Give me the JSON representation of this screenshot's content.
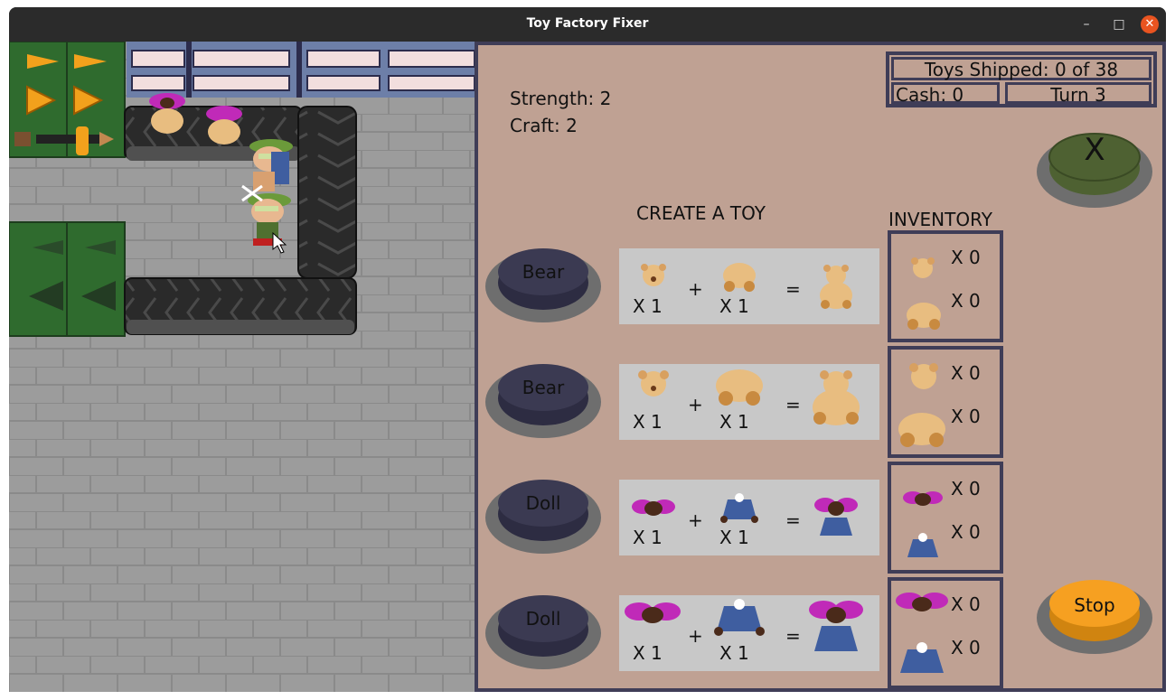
{
  "window": {
    "title": "Toy Factory Fixer",
    "minimize": "–",
    "maximize": "□",
    "close": "✕"
  },
  "stats": {
    "strength": "Strength: 2",
    "craft": "Craft: 2"
  },
  "status": {
    "toys_shipped": "Toys Shipped: 0 of 38",
    "cash": "Cash: 0",
    "turn": "Turn 3"
  },
  "controls": {
    "x_label": "X",
    "stop_label": "Stop"
  },
  "create": {
    "heading": "CREATE A TOY"
  },
  "inventory_heading": "INVENTORY",
  "recipes": [
    {
      "button": "Bear",
      "part_a": "X 1",
      "plus": "+",
      "part_b": "X 1",
      "eq": "="
    },
    {
      "button": "Bear",
      "part_a": "X 1",
      "plus": "+",
      "part_b": "X 1",
      "eq": "="
    },
    {
      "button": "Doll",
      "part_a": "X 1",
      "plus": "+",
      "part_b": "X 1",
      "eq": "="
    },
    {
      "button": "Doll",
      "part_a": "X 1",
      "plus": "+",
      "part_b": "X 1",
      "eq": "="
    }
  ],
  "inventory": [
    {
      "a": "X 0",
      "b": "X 0"
    },
    {
      "a": "X 0",
      "b": "X 0"
    },
    {
      "a": "X 0",
      "b": "X 0"
    },
    {
      "a": "X 0",
      "b": "X 0"
    }
  ],
  "colors": {
    "panel_bg": "#bfa193",
    "border": "#3f3d57",
    "button_dark": "#3b3a52",
    "x_button": "#4e6132",
    "stop_button": "#f6a021",
    "conveyor": "#2a2a2a",
    "machine": "#2f6b2e",
    "brick": "#9a9a9a"
  }
}
